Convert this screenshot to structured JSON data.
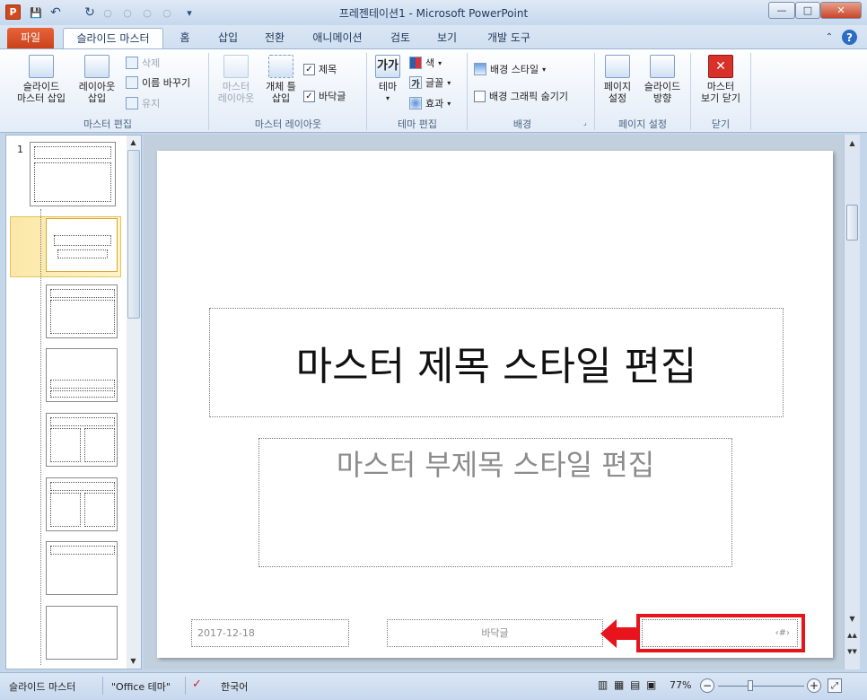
{
  "window": {
    "app_icon": "P",
    "title": "프레젠테이션1 - Microsoft PowerPoint",
    "minimize": "—",
    "maximize": "□",
    "close": "✕"
  },
  "qat": {
    "save_icon": "💾",
    "undo_icon": "↶",
    "redo_icon": "↻",
    "more": "▾"
  },
  "tabs": {
    "file": "파일",
    "items": [
      "슬라이드 마스터",
      "홈",
      "삽입",
      "전환",
      "애니메이션",
      "검토",
      "보기",
      "개발 도구"
    ],
    "help_icon": "?"
  },
  "ribbon": {
    "master_edit": {
      "label": "마스터 편집",
      "insert_master": "슬라이드\n마스터 삽입",
      "insert_layout": "레이아웃\n삽입",
      "delete": "삭제",
      "rename": "이름 바꾸기",
      "preserve": "유지"
    },
    "master_layout": {
      "label": "마스터 레이아웃",
      "master_layout_btn": "마스터\n레이아웃",
      "insert_placeholder": "개체 틀\n삽입",
      "title_chk": "제목",
      "footer_chk": "바닥글"
    },
    "theme_edit": {
      "label": "테마 편집",
      "theme": "테마",
      "colors": "색",
      "fonts": "글꼴",
      "effects": "효과",
      "theme_icon_text": "가가",
      "font_icon_text": "가"
    },
    "background": {
      "label": "배경",
      "bg_style": "배경 스타일",
      "hide_bg": "배경 그래픽 숨기기"
    },
    "page_setup": {
      "label": "페이지 설정",
      "page_setup": "페이지\n설정",
      "orientation": "슬라이드\n방향"
    },
    "close": {
      "label": "닫기",
      "close_master": "마스터\n보기 닫기"
    }
  },
  "thumbnails": {
    "first_number": "1"
  },
  "slide": {
    "title": "마스터 제목 스타일 편집",
    "subtitle": "마스터 부제목 스타일 편집",
    "date": "2017-12-18",
    "footer": "바닥글",
    "slide_number": "‹#›"
  },
  "status": {
    "view": "슬라이드 마스터",
    "theme": "\"Office 테마\"",
    "language": "한국어",
    "zoom": "77%",
    "zoom_level": 0.77
  },
  "colors": {
    "annotation_red": "#e8141b",
    "file_tab": "#d9512a",
    "selected_thumb": "#fbe7a7"
  }
}
